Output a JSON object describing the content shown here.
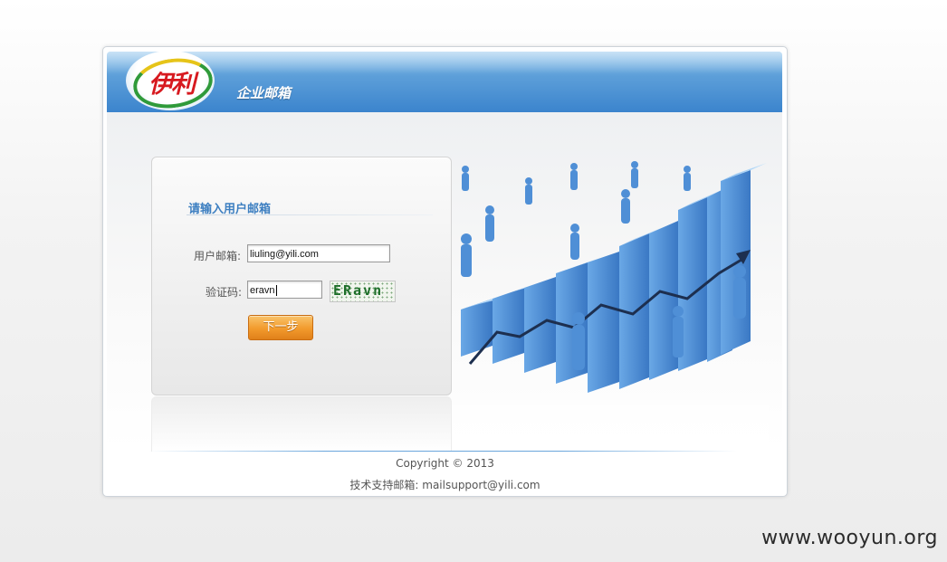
{
  "header": {
    "logo_text": "伊利",
    "title": "企业邮箱"
  },
  "login_panel": {
    "heading": "请输入用户邮箱",
    "username_label": "用户邮箱:",
    "username_value": "liuling@yili.com",
    "captcha_label": "验证码:",
    "captcha_value": "eravn",
    "captcha_image_text": "ERavn",
    "next_button": "下一步"
  },
  "footer": {
    "copyright": "Copyright © 2013",
    "support": "技术支持邮箱: mailsupport@yili.com"
  },
  "watermark": "www.wooyun.org",
  "colors": {
    "header_blue": "#3b84cd",
    "heading_blue": "#3d7fc1",
    "button_orange": "#f29a2c",
    "bar_blue": "#4f8fd6"
  }
}
